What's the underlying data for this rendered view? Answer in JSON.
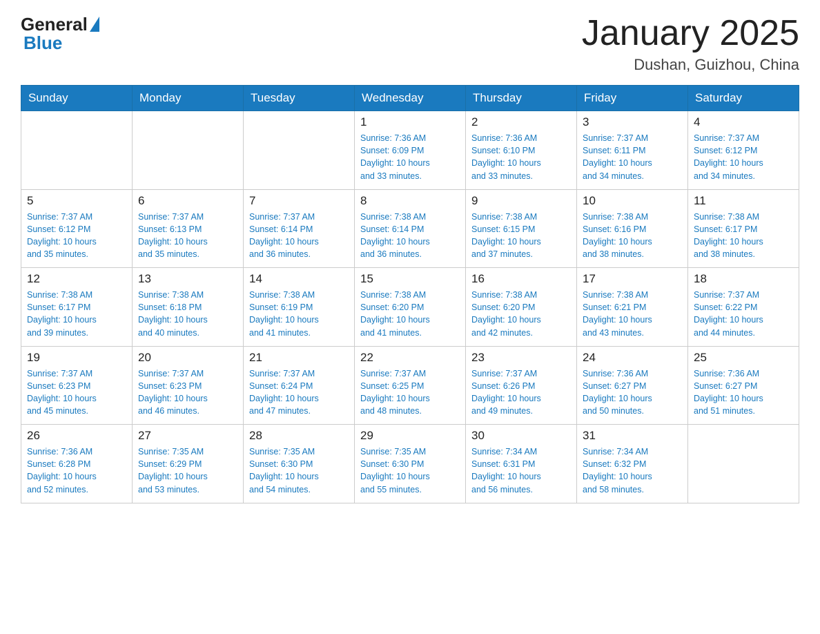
{
  "header": {
    "logo_general": "General",
    "logo_blue": "Blue",
    "title": "January 2025",
    "subtitle": "Dushan, Guizhou, China"
  },
  "days_of_week": [
    "Sunday",
    "Monday",
    "Tuesday",
    "Wednesday",
    "Thursday",
    "Friday",
    "Saturday"
  ],
  "weeks": [
    [
      {
        "day": "",
        "info": ""
      },
      {
        "day": "",
        "info": ""
      },
      {
        "day": "",
        "info": ""
      },
      {
        "day": "1",
        "info": "Sunrise: 7:36 AM\nSunset: 6:09 PM\nDaylight: 10 hours\nand 33 minutes."
      },
      {
        "day": "2",
        "info": "Sunrise: 7:36 AM\nSunset: 6:10 PM\nDaylight: 10 hours\nand 33 minutes."
      },
      {
        "day": "3",
        "info": "Sunrise: 7:37 AM\nSunset: 6:11 PM\nDaylight: 10 hours\nand 34 minutes."
      },
      {
        "day": "4",
        "info": "Sunrise: 7:37 AM\nSunset: 6:12 PM\nDaylight: 10 hours\nand 34 minutes."
      }
    ],
    [
      {
        "day": "5",
        "info": "Sunrise: 7:37 AM\nSunset: 6:12 PM\nDaylight: 10 hours\nand 35 minutes."
      },
      {
        "day": "6",
        "info": "Sunrise: 7:37 AM\nSunset: 6:13 PM\nDaylight: 10 hours\nand 35 minutes."
      },
      {
        "day": "7",
        "info": "Sunrise: 7:37 AM\nSunset: 6:14 PM\nDaylight: 10 hours\nand 36 minutes."
      },
      {
        "day": "8",
        "info": "Sunrise: 7:38 AM\nSunset: 6:14 PM\nDaylight: 10 hours\nand 36 minutes."
      },
      {
        "day": "9",
        "info": "Sunrise: 7:38 AM\nSunset: 6:15 PM\nDaylight: 10 hours\nand 37 minutes."
      },
      {
        "day": "10",
        "info": "Sunrise: 7:38 AM\nSunset: 6:16 PM\nDaylight: 10 hours\nand 38 minutes."
      },
      {
        "day": "11",
        "info": "Sunrise: 7:38 AM\nSunset: 6:17 PM\nDaylight: 10 hours\nand 38 minutes."
      }
    ],
    [
      {
        "day": "12",
        "info": "Sunrise: 7:38 AM\nSunset: 6:17 PM\nDaylight: 10 hours\nand 39 minutes."
      },
      {
        "day": "13",
        "info": "Sunrise: 7:38 AM\nSunset: 6:18 PM\nDaylight: 10 hours\nand 40 minutes."
      },
      {
        "day": "14",
        "info": "Sunrise: 7:38 AM\nSunset: 6:19 PM\nDaylight: 10 hours\nand 41 minutes."
      },
      {
        "day": "15",
        "info": "Sunrise: 7:38 AM\nSunset: 6:20 PM\nDaylight: 10 hours\nand 41 minutes."
      },
      {
        "day": "16",
        "info": "Sunrise: 7:38 AM\nSunset: 6:20 PM\nDaylight: 10 hours\nand 42 minutes."
      },
      {
        "day": "17",
        "info": "Sunrise: 7:38 AM\nSunset: 6:21 PM\nDaylight: 10 hours\nand 43 minutes."
      },
      {
        "day": "18",
        "info": "Sunrise: 7:37 AM\nSunset: 6:22 PM\nDaylight: 10 hours\nand 44 minutes."
      }
    ],
    [
      {
        "day": "19",
        "info": "Sunrise: 7:37 AM\nSunset: 6:23 PM\nDaylight: 10 hours\nand 45 minutes."
      },
      {
        "day": "20",
        "info": "Sunrise: 7:37 AM\nSunset: 6:23 PM\nDaylight: 10 hours\nand 46 minutes."
      },
      {
        "day": "21",
        "info": "Sunrise: 7:37 AM\nSunset: 6:24 PM\nDaylight: 10 hours\nand 47 minutes."
      },
      {
        "day": "22",
        "info": "Sunrise: 7:37 AM\nSunset: 6:25 PM\nDaylight: 10 hours\nand 48 minutes."
      },
      {
        "day": "23",
        "info": "Sunrise: 7:37 AM\nSunset: 6:26 PM\nDaylight: 10 hours\nand 49 minutes."
      },
      {
        "day": "24",
        "info": "Sunrise: 7:36 AM\nSunset: 6:27 PM\nDaylight: 10 hours\nand 50 minutes."
      },
      {
        "day": "25",
        "info": "Sunrise: 7:36 AM\nSunset: 6:27 PM\nDaylight: 10 hours\nand 51 minutes."
      }
    ],
    [
      {
        "day": "26",
        "info": "Sunrise: 7:36 AM\nSunset: 6:28 PM\nDaylight: 10 hours\nand 52 minutes."
      },
      {
        "day": "27",
        "info": "Sunrise: 7:35 AM\nSunset: 6:29 PM\nDaylight: 10 hours\nand 53 minutes."
      },
      {
        "day": "28",
        "info": "Sunrise: 7:35 AM\nSunset: 6:30 PM\nDaylight: 10 hours\nand 54 minutes."
      },
      {
        "day": "29",
        "info": "Sunrise: 7:35 AM\nSunset: 6:30 PM\nDaylight: 10 hours\nand 55 minutes."
      },
      {
        "day": "30",
        "info": "Sunrise: 7:34 AM\nSunset: 6:31 PM\nDaylight: 10 hours\nand 56 minutes."
      },
      {
        "day": "31",
        "info": "Sunrise: 7:34 AM\nSunset: 6:32 PM\nDaylight: 10 hours\nand 58 minutes."
      },
      {
        "day": "",
        "info": ""
      }
    ]
  ]
}
